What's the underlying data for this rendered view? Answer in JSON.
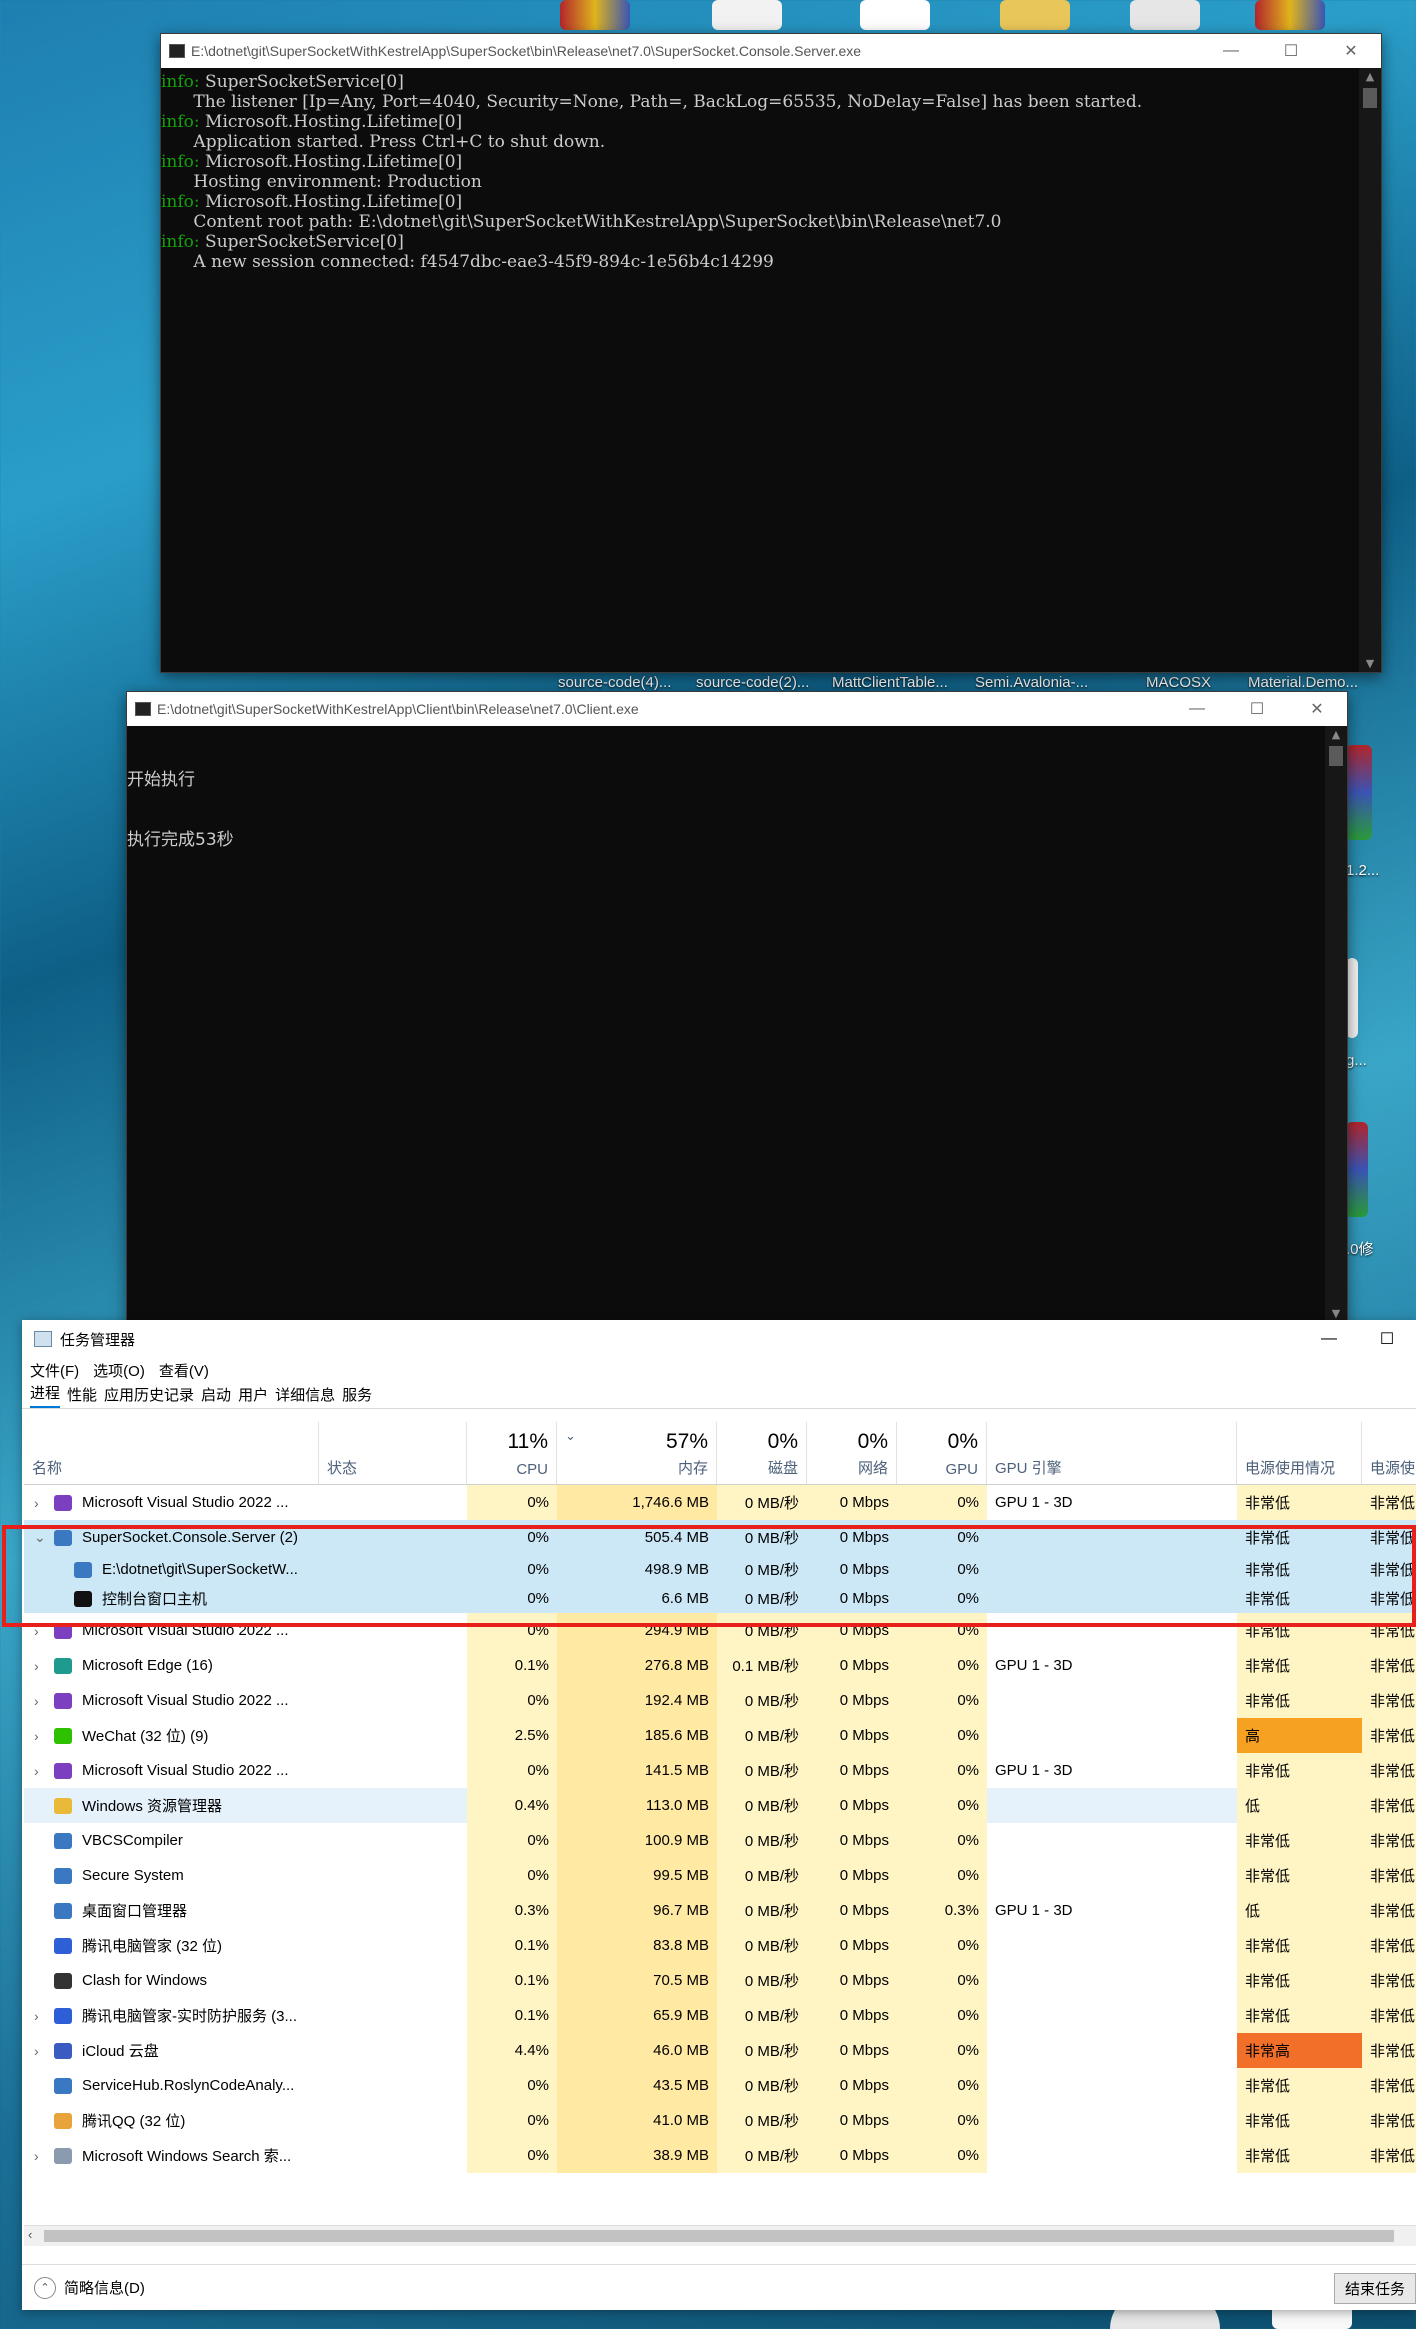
{
  "colors": {
    "console_bg": "#0c0c0c",
    "console_info": "#13a10e",
    "row_highlight": "#cce8f7",
    "heat_light": "#fff4c4",
    "heat_mid": "#ffe9a3",
    "heat_high": "#f7a123",
    "heat_very_high": "#f26f2a",
    "highlight_box": "#e8201c"
  },
  "desktop": {
    "labels": [
      "source-code(4)...",
      "source-code(2)...",
      "MattClientTable...",
      "Semi.Avalonia-...",
      "MACOSX",
      "Material.Demo...",
      "1.2...",
      "g...",
      ".0修"
    ]
  },
  "server_console": {
    "title": "E:\\dotnet\\git\\SuperSocketWithKestrelApp\\SuperSocket\\bin\\Release\\net7.0\\SuperSocket.Console.Server.exe",
    "lines": [
      {
        "prefix": "info: ",
        "text": "SuperSocketService[0]"
      },
      {
        "prefix": "",
        "text": "      The listener [Ip=Any, Port=4040, Security=None, Path=, BackLog=65535, NoDelay=False] has been started."
      },
      {
        "prefix": "info: ",
        "text": "Microsoft.Hosting.Lifetime[0]"
      },
      {
        "prefix": "",
        "text": "      Application started. Press Ctrl+C to shut down."
      },
      {
        "prefix": "info: ",
        "text": "Microsoft.Hosting.Lifetime[0]"
      },
      {
        "prefix": "",
        "text": "      Hosting environment: Production"
      },
      {
        "prefix": "info: ",
        "text": "Microsoft.Hosting.Lifetime[0]"
      },
      {
        "prefix": "",
        "text": "      Content root path: E:\\dotnet\\git\\SuperSocketWithKestrelApp\\SuperSocket\\bin\\Release\\net7.0"
      },
      {
        "prefix": "info: ",
        "text": "SuperSocketService[0]"
      },
      {
        "prefix": "",
        "text": "      A new session connected: f4547dbc-eae3-45f9-894c-1e56b4c14299"
      }
    ]
  },
  "client_console": {
    "title": "E:\\dotnet\\git\\SuperSocketWithKestrelApp\\Client\\bin\\Release\\net7.0\\Client.exe",
    "lines": [
      "开始执行",
      "执行完成53秒"
    ]
  },
  "task_manager": {
    "title": "任务管理器",
    "menu": [
      "文件(F)",
      "选项(O)",
      "查看(V)"
    ],
    "tabs": [
      "进程",
      "性能",
      "应用历史记录",
      "启动",
      "用户",
      "详细信息",
      "服务"
    ],
    "active_tab": "进程",
    "header": {
      "name": "名称",
      "status": "状态",
      "cpu_pct": "11%",
      "cpu": "CPU",
      "mem_pct": "57%",
      "mem": "内存",
      "disk_pct": "0%",
      "disk": "磁盘",
      "net_pct": "0%",
      "net": "网络",
      "gpu_pct": "0%",
      "gpu": "GPU",
      "gpu_engine": "GPU 引擎",
      "power": "电源使用情况",
      "power_trend": "电源使"
    },
    "rows": [
      {
        "expand": "›",
        "icon": "vs-icon",
        "name": "Microsoft Visual Studio 2022 ...",
        "cpu": "0%",
        "mem": "1,746.6 MB",
        "disk": "0 MB/秒",
        "net": "0 Mbps",
        "gpu": "0%",
        "engine": "GPU 1 - 3D",
        "power": "非常低",
        "trend": "非常低",
        "sub": false,
        "selected": false,
        "power_level": "low"
      },
      {
        "expand": "⌄",
        "icon": "app-icon",
        "name": "SuperSocket.Console.Server (2)",
        "cpu": "0%",
        "mem": "505.4 MB",
        "disk": "0 MB/秒",
        "net": "0 Mbps",
        "gpu": "0%",
        "engine": "",
        "power": "非常低",
        "trend": "非常低",
        "sub": false,
        "selected": true,
        "power_level": "low"
      },
      {
        "expand": "",
        "icon": "app-icon",
        "name": "E:\\dotnet\\git\\SuperSocketW...",
        "cpu": "0%",
        "mem": "498.9 MB",
        "disk": "0 MB/秒",
        "net": "0 Mbps",
        "gpu": "0%",
        "engine": "",
        "power": "非常低",
        "trend": "非常低",
        "sub": true,
        "selected": true,
        "power_level": "low"
      },
      {
        "expand": "",
        "icon": "console-icon",
        "name": "控制台窗口主机",
        "cpu": "0%",
        "mem": "6.6 MB",
        "disk": "0 MB/秒",
        "net": "0 Mbps",
        "gpu": "0%",
        "engine": "",
        "power": "非常低",
        "trend": "非常低",
        "sub": true,
        "selected": true,
        "power_level": "low"
      },
      {
        "expand": "›",
        "icon": "vs-icon",
        "name": "Microsoft Visual Studio 2022 ...",
        "cpu": "0%",
        "mem": "294.9 MB",
        "disk": "0 MB/秒",
        "net": "0 Mbps",
        "gpu": "0%",
        "engine": "",
        "power": "非常低",
        "trend": "非常低",
        "sub": false,
        "selected": false,
        "power_level": "low"
      },
      {
        "expand": "›",
        "icon": "edge-icon",
        "name": "Microsoft Edge (16)",
        "cpu": "0.1%",
        "mem": "276.8 MB",
        "disk": "0.1 MB/秒",
        "net": "0 Mbps",
        "gpu": "0%",
        "engine": "GPU 1 - 3D",
        "power": "非常低",
        "trend": "非常低",
        "sub": false,
        "selected": false,
        "power_level": "low"
      },
      {
        "expand": "›",
        "icon": "vs-icon",
        "name": "Microsoft Visual Studio 2022 ...",
        "cpu": "0%",
        "mem": "192.4 MB",
        "disk": "0 MB/秒",
        "net": "0 Mbps",
        "gpu": "0%",
        "engine": "",
        "power": "非常低",
        "trend": "非常低",
        "sub": false,
        "selected": false,
        "power_level": "low"
      },
      {
        "expand": "›",
        "icon": "wechat-icon",
        "name": "WeChat (32 位) (9)",
        "cpu": "2.5%",
        "mem": "185.6 MB",
        "disk": "0 MB/秒",
        "net": "0 Mbps",
        "gpu": "0%",
        "engine": "",
        "power": "高",
        "trend": "非常低",
        "sub": false,
        "selected": false,
        "power_level": "high"
      },
      {
        "expand": "›",
        "icon": "vs-icon",
        "name": "Microsoft Visual Studio 2022 ...",
        "cpu": "0%",
        "mem": "141.5 MB",
        "disk": "0 MB/秒",
        "net": "0 Mbps",
        "gpu": "0%",
        "engine": "GPU 1 - 3D",
        "power": "非常低",
        "trend": "非常低",
        "sub": false,
        "selected": false,
        "power_level": "low"
      },
      {
        "expand": "",
        "icon": "folder-icon",
        "name": "Windows 资源管理器",
        "cpu": "0.4%",
        "mem": "113.0 MB",
        "disk": "0 MB/秒",
        "net": "0 Mbps",
        "gpu": "0%",
        "engine": "",
        "power": "低",
        "trend": "非常低",
        "sub": false,
        "selected": false,
        "focused": true,
        "power_level": "low"
      },
      {
        "expand": "",
        "icon": "app-icon",
        "name": "VBCSCompiler",
        "cpu": "0%",
        "mem": "100.9 MB",
        "disk": "0 MB/秒",
        "net": "0 Mbps",
        "gpu": "0%",
        "engine": "",
        "power": "非常低",
        "trend": "非常低",
        "sub": false,
        "selected": false,
        "power_level": "low"
      },
      {
        "expand": "",
        "icon": "app-icon",
        "name": "Secure System",
        "cpu": "0%",
        "mem": "99.5 MB",
        "disk": "0 MB/秒",
        "net": "0 Mbps",
        "gpu": "0%",
        "engine": "",
        "power": "非常低",
        "trend": "非常低",
        "sub": false,
        "selected": false,
        "power_level": "low"
      },
      {
        "expand": "",
        "icon": "app-icon",
        "name": "桌面窗口管理器",
        "cpu": "0.3%",
        "mem": "96.7 MB",
        "disk": "0 MB/秒",
        "net": "0 Mbps",
        "gpu": "0.3%",
        "engine": "GPU 1 - 3D",
        "power": "低",
        "trend": "非常低",
        "sub": false,
        "selected": false,
        "power_level": "low"
      },
      {
        "expand": "",
        "icon": "shield-icon",
        "name": "腾讯电脑管家 (32 位)",
        "cpu": "0.1%",
        "mem": "83.8 MB",
        "disk": "0 MB/秒",
        "net": "0 Mbps",
        "gpu": "0%",
        "engine": "",
        "power": "非常低",
        "trend": "非常低",
        "sub": false,
        "selected": false,
        "power_level": "low"
      },
      {
        "expand": "",
        "icon": "clash-icon",
        "name": "Clash for Windows",
        "cpu": "0.1%",
        "mem": "70.5 MB",
        "disk": "0 MB/秒",
        "net": "0 Mbps",
        "gpu": "0%",
        "engine": "",
        "power": "非常低",
        "trend": "非常低",
        "sub": false,
        "selected": false,
        "power_level": "low"
      },
      {
        "expand": "›",
        "icon": "shield-icon",
        "name": "腾讯电脑管家-实时防护服务 (3...",
        "cpu": "0.1%",
        "mem": "65.9 MB",
        "disk": "0 MB/秒",
        "net": "0 Mbps",
        "gpu": "0%",
        "engine": "",
        "power": "非常低",
        "trend": "非常低",
        "sub": false,
        "selected": false,
        "power_level": "low"
      },
      {
        "expand": "›",
        "icon": "icloud-icon",
        "name": "iCloud 云盘",
        "cpu": "4.4%",
        "mem": "46.0 MB",
        "disk": "0 MB/秒",
        "net": "0 Mbps",
        "gpu": "0%",
        "engine": "",
        "power": "非常高",
        "trend": "非常低",
        "sub": false,
        "selected": false,
        "power_level": "very_high"
      },
      {
        "expand": "",
        "icon": "app-icon",
        "name": "ServiceHub.RoslynCodeAnaly...",
        "cpu": "0%",
        "mem": "43.5 MB",
        "disk": "0 MB/秒",
        "net": "0 Mbps",
        "gpu": "0%",
        "engine": "",
        "power": "非常低",
        "trend": "非常低",
        "sub": false,
        "selected": false,
        "power_level": "low"
      },
      {
        "expand": "",
        "icon": "qq-icon",
        "name": "腾讯QQ (32 位)",
        "cpu": "0%",
        "mem": "41.0 MB",
        "disk": "0 MB/秒",
        "net": "0 Mbps",
        "gpu": "0%",
        "engine": "",
        "power": "非常低",
        "trend": "非常低",
        "sub": false,
        "selected": false,
        "power_level": "low"
      },
      {
        "expand": "›",
        "icon": "search-icon",
        "name": "Microsoft Windows Search 索...",
        "cpu": "0%",
        "mem": "38.9 MB",
        "disk": "0 MB/秒",
        "net": "0 Mbps",
        "gpu": "0%",
        "engine": "",
        "power": "非常低",
        "trend": "非常低",
        "sub": false,
        "selected": false,
        "power_level": "low"
      }
    ],
    "footer": {
      "summary": "简略信息(D)",
      "end_task": "结束任务"
    }
  }
}
